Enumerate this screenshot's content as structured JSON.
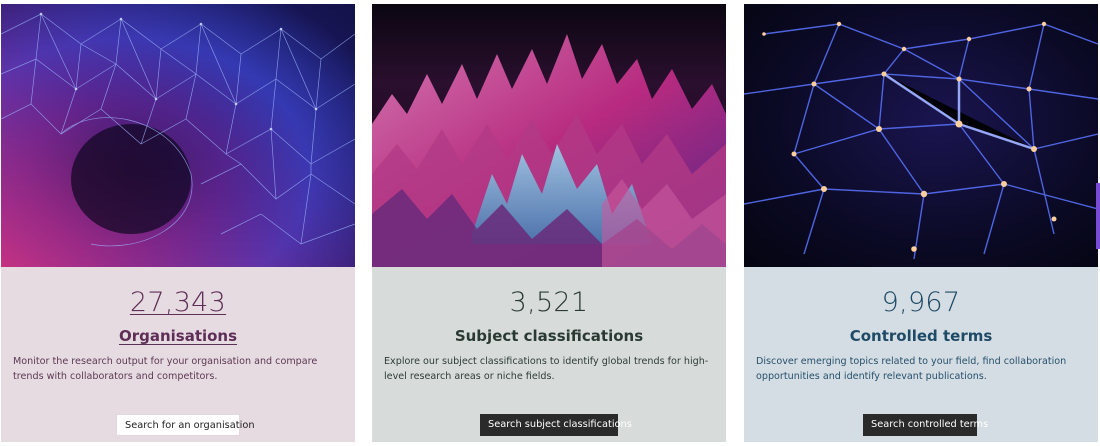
{
  "cards": [
    {
      "count": "27,343",
      "title": "Organisations",
      "description": "Monitor the research output for your organisation and compare trends with collaborators and competitors.",
      "button": "Search for an organisation"
    },
    {
      "count": "3,521",
      "title": "Subject classifications",
      "description": "Explore our subject classifications to identify global trends for high-level research areas or niche fields.",
      "button": "Search subject classifications"
    },
    {
      "count": "9,967",
      "title": "Controlled terms",
      "description": "Discover emerging topics related to your field, find collaboration opportunities and identify relevant publications.",
      "button": "Search controlled terms"
    }
  ],
  "colors": {
    "card1_bg": "#e7dbe2",
    "card2_bg": "#d7dcda",
    "card3_bg": "#d4dde3",
    "button_dark": "#2a2a2a",
    "accent": "#7a4bd6"
  }
}
